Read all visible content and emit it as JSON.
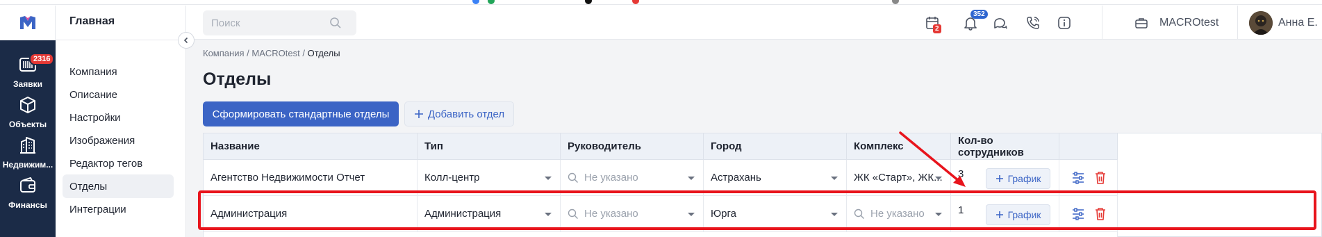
{
  "app": {
    "logo_icon": "m-logo-icon",
    "accent_color": "#3b64c5",
    "rail_color": "#1b2b47"
  },
  "rail": {
    "items": [
      {
        "label": "Заявки",
        "icon": "barcode-icon",
        "badge": "2316"
      },
      {
        "label": "Объекты",
        "icon": "cube-icon"
      },
      {
        "label": "Недвижим...",
        "icon": "building-icon"
      },
      {
        "label": "Финансы",
        "icon": "wallet-icon"
      }
    ]
  },
  "secondary_nav": {
    "title": "Главная",
    "items": [
      {
        "label": "Компания"
      },
      {
        "label": "Описание"
      },
      {
        "label": "Настройки"
      },
      {
        "label": "Изображения"
      },
      {
        "label": "Редактор тегов"
      },
      {
        "label": "Отделы",
        "active": true
      },
      {
        "label": "Интеграции"
      }
    ]
  },
  "topbar": {
    "search_placeholder": "Поиск",
    "calendar_badge": "2",
    "notifications_badge": "352",
    "company_name": "MACROtest",
    "user_name": "Анна Е."
  },
  "breadcrumb": {
    "items": [
      "Компания",
      "MACROtest"
    ],
    "separator": "/",
    "current": "Отделы"
  },
  "page": {
    "title": "Отделы",
    "primary_button": "Сформировать стандартные отделы",
    "secondary_button": "Добавить отдел"
  },
  "table": {
    "columns": [
      "Название",
      "Тип",
      "Руководитель",
      "Город",
      "Комплекс",
      "Кол-во сотрудников"
    ],
    "graph_label": "График",
    "rows": [
      {
        "name": "Агентство Недвижимости Отчет",
        "type": "Колл-центр",
        "manager": "Не указано",
        "manager_empty": true,
        "city": "Астрахань",
        "complex": "ЖК «Старт», ЖК...",
        "complex_empty": false,
        "count": "3"
      },
      {
        "name": "Администрация",
        "type": "Администрация",
        "manager": "Не указано",
        "manager_empty": true,
        "city": "Юрга",
        "complex": "Не указано",
        "complex_empty": true,
        "count": "1",
        "highlighted": true
      }
    ]
  },
  "annotation": {
    "highlight_color": "#e8141c"
  }
}
